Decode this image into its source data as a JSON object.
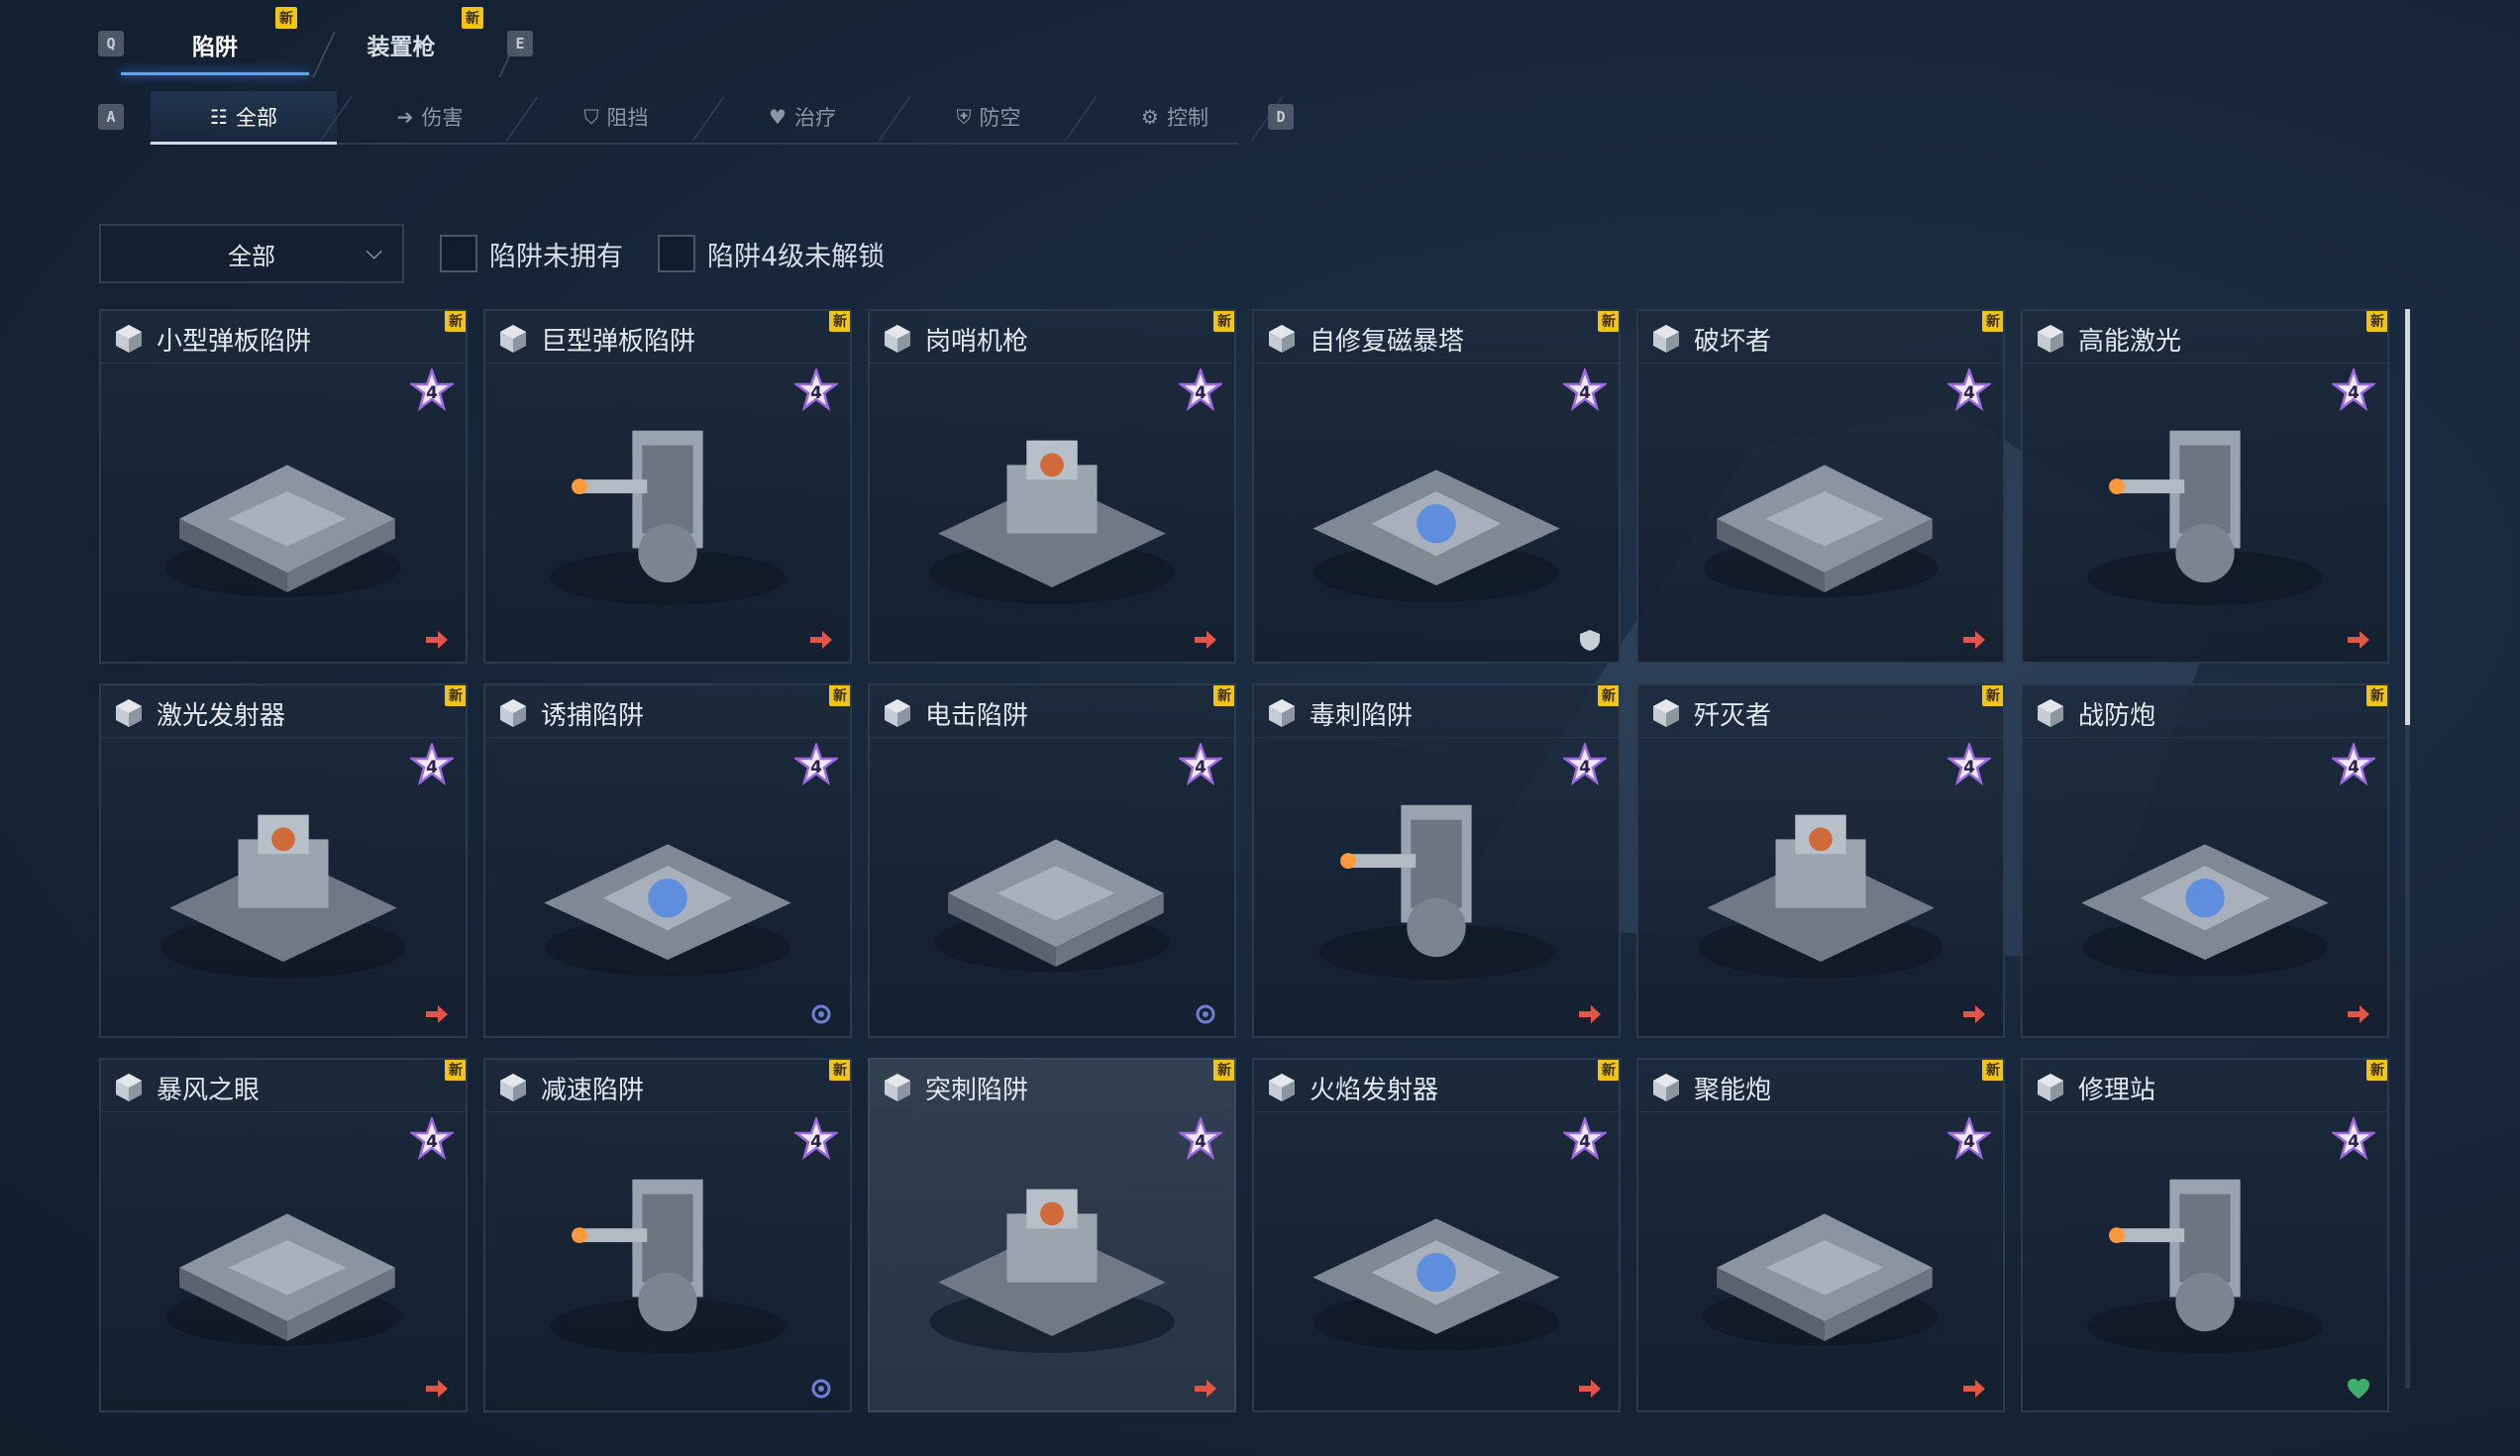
{
  "keys": {
    "prev_tab": "Q",
    "next_tab": "E",
    "prev_sub": "A",
    "next_sub": "D"
  },
  "top_tabs": [
    {
      "label": "陷阱",
      "sub": "",
      "active": true,
      "new": "新"
    },
    {
      "label": "装置枪",
      "active": false,
      "new": "新"
    }
  ],
  "sub_tabs": [
    {
      "label": "全部",
      "icon": "list-icon",
      "active": true
    },
    {
      "label": "伤害",
      "icon": "arrow-right-icon",
      "active": false
    },
    {
      "label": "阻挡",
      "icon": "shield-icon",
      "active": false
    },
    {
      "label": "治疗",
      "icon": "heart-plus-icon",
      "active": false
    },
    {
      "label": "防空",
      "icon": "shield-plus-icon",
      "active": false
    },
    {
      "label": "控制",
      "icon": "gear-icon",
      "active": false
    }
  ],
  "filters": {
    "dropdown_value": "全部",
    "checkbox_not_owned": "陷阱未拥有",
    "checkbox_lv4_locked": "陷阱4级未解锁"
  },
  "badge_new": "新",
  "star_level": "4",
  "cards": [
    {
      "name": "小型弹板陷阱",
      "corner": "damage"
    },
    {
      "name": "巨型弹板陷阱",
      "corner": "damage"
    },
    {
      "name": "岗哨机枪",
      "corner": "damage"
    },
    {
      "name": "自修复磁暴塔",
      "corner": "block"
    },
    {
      "name": "破坏者",
      "corner": "damage"
    },
    {
      "name": "高能激光",
      "corner": "damage"
    },
    {
      "name": "激光发射器",
      "corner": "damage"
    },
    {
      "name": "诱捕陷阱",
      "corner": "control"
    },
    {
      "name": "电击陷阱",
      "corner": "control"
    },
    {
      "name": "毒刺陷阱",
      "corner": "damage"
    },
    {
      "name": "歼灭者",
      "corner": "damage"
    },
    {
      "name": "战防炮",
      "corner": "damage"
    },
    {
      "name": "暴风之眼",
      "corner": "damage"
    },
    {
      "name": "减速陷阱",
      "corner": "control"
    },
    {
      "name": "突刺陷阱",
      "corner": "damage"
    },
    {
      "name": "火焰发射器",
      "corner": "damage"
    },
    {
      "name": "聚能炮",
      "corner": "damage"
    },
    {
      "name": "修理站",
      "corner": "heal"
    }
  ],
  "colors": {
    "accent_blue": "#5aa6ff",
    "badge_yellow": "#f0c419",
    "damage_red": "#e0574a",
    "control_blue": "#6f7fd6",
    "heal_green": "#3fae6b",
    "star_purple": "#b58df0"
  }
}
